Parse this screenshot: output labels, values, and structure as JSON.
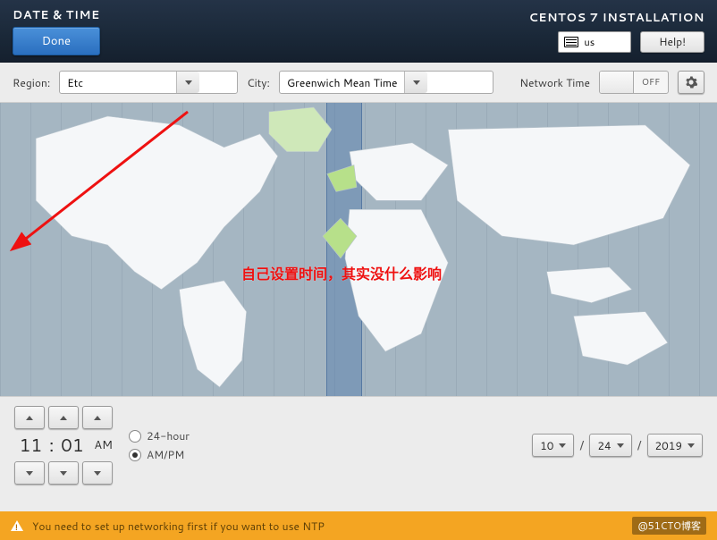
{
  "header": {
    "spoke_title": "DATE & TIME",
    "done_label": "Done",
    "product_title": "CENTOS 7 INSTALLATION",
    "keyboard_layout": "us",
    "help_label": "Help!"
  },
  "location": {
    "region_label": "Region:",
    "region_value": "Etc",
    "city_label": "City:",
    "city_value": "Greenwich Mean Time"
  },
  "network_time": {
    "label": "Network Time",
    "state": "OFF"
  },
  "annotation": {
    "text": "自己设置时间，其实没什么影响"
  },
  "time": {
    "hours": "11",
    "minutes": "01",
    "ampm": "AM"
  },
  "time_format": {
    "opt24": "24-hour",
    "optampm": "AM/PM",
    "selected": "ampm"
  },
  "date": {
    "month": "10",
    "day": "24",
    "year": "2019",
    "sep": "/"
  },
  "warning": {
    "text": "You need to set up networking first if you want to use NTP"
  },
  "watermark": "@51CTO博客"
}
